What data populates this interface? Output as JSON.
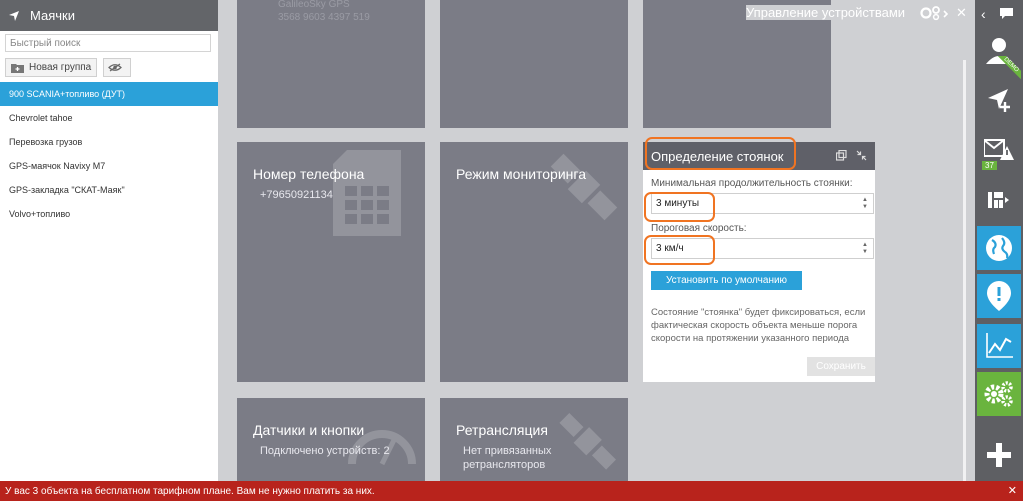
{
  "sidebar": {
    "title": "Маячки",
    "search_placeholder": "Быстрый поиск",
    "new_group_label": "Новая группа",
    "items": [
      {
        "label": "900 SCANIA+топливо (ДУТ)"
      },
      {
        "label": "Chevrolet tahoe"
      },
      {
        "label": "Перевозка грузов"
      },
      {
        "label": "GPS-маячок Navixy M7"
      },
      {
        "label": "GPS-закладка \"СКАТ-Маяк\""
      },
      {
        "label": "Volvo+топливо"
      }
    ]
  },
  "main": {
    "manager_title": "Управление устройствами",
    "device_faint": [
      "GalileoSky GPS",
      "3568 9603 4397 519"
    ],
    "tiles": {
      "phone": {
        "title": "Номер телефона",
        "sub": "+79650921134"
      },
      "monitoring": {
        "title": "Режим мониторинга"
      },
      "sensors": {
        "title": "Датчики и кнопки",
        "sub": "Подключено устройств: 2"
      },
      "relay": {
        "title": "Ретрансляция",
        "sub1": "Нет привязанных",
        "sub2": "ретрансляторов"
      }
    },
    "parking": {
      "title": "Определение стоянок",
      "min_duration_label": "Минимальная продолжительность стоянки:",
      "min_duration_value": "3 минуты",
      "speed_label": "Пороговая скорость:",
      "speed_value": "3 км/ч",
      "default_button": "Установить по умолчанию",
      "description": "Состояние \"стоянка\" будет фиксироваться, если фактическая скорость объекта меньше порога скорости на протяжении указанного периода",
      "save_button": "Сохранить"
    }
  },
  "rightbar": {
    "demo_label": "DEMO",
    "messages_count": "37"
  },
  "bottom_bar": {
    "message": "У вас 3 объекта на бесплатном тарифном плане. Вам не нужно платить за них."
  },
  "colors": {
    "accent_blue": "#2ba1d9",
    "accent_green": "#6ab43e",
    "highlight_orange": "#f07422",
    "alert_red": "#b8231c"
  }
}
